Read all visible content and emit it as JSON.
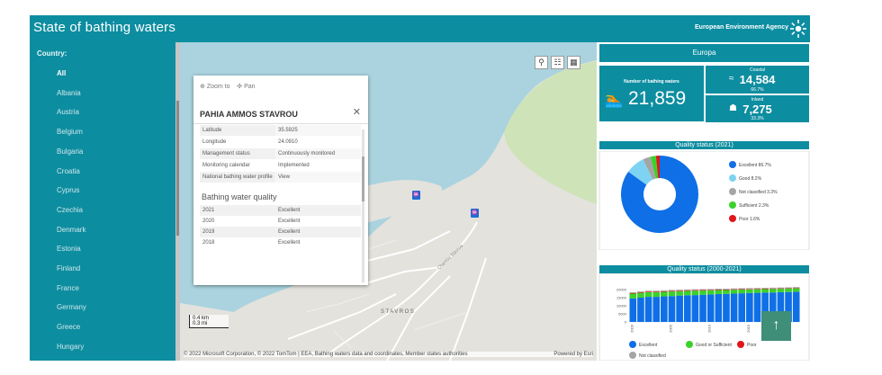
{
  "header": {
    "title": "State of bathing waters",
    "agency": "European Environment Agency"
  },
  "sidebar": {
    "label": "Country:",
    "countries": [
      "All",
      "Albania",
      "Austria",
      "Belgium",
      "Bulgaria",
      "Croatia",
      "Cyprus",
      "Czechia",
      "Denmark",
      "Estonia",
      "Finland",
      "France",
      "Germany",
      "Greece",
      "Hungary"
    ],
    "selected": "All"
  },
  "map": {
    "buttons": {
      "search": "⚲",
      "list": "☷",
      "grid": "▦"
    },
    "place_label": "STAVROS",
    "road_label": "Chaniou Stavrou",
    "scale": {
      "km": "0.4 km",
      "mi": "0.3 mi"
    },
    "attribution": "© 2022 Microsoft Corporation, © 2022 TomTom | EEA, Bathing waters data and coordinates, Member states authorities",
    "powered_by": "Powered by Esri"
  },
  "popup": {
    "zoom_to": "Zoom to",
    "pan": "Pan",
    "title": "PAHIA AMMOS STAVROU",
    "close": "✕",
    "properties": [
      {
        "key": "Latitude",
        "value": "35.5925"
      },
      {
        "key": "Longitude",
        "value": "24.0910"
      },
      {
        "key": "Management status",
        "value": "Continuously monitored"
      },
      {
        "key": "Monitoring calendar",
        "value": "Implemented"
      },
      {
        "key": "National bathing water profile",
        "value": "View"
      }
    ],
    "quality_title": "Bathing water quality",
    "quality": [
      {
        "year": "2021",
        "value": "Excellent"
      },
      {
        "year": "2020",
        "value": "Excellent"
      },
      {
        "year": "2019",
        "value": "Excellent"
      },
      {
        "year": "2018",
        "value": "Excellent"
      }
    ]
  },
  "panel": {
    "region": "Europa",
    "total": {
      "caption": "Number of bathing waters",
      "value": "21,859"
    },
    "coastal": {
      "caption": "Coastal",
      "value": "14,584",
      "pct": "66.7%"
    },
    "inland": {
      "caption": "Inland",
      "value": "7,275",
      "pct": "33.3%"
    },
    "quality_2021_title": "Quality status (2021)",
    "quality_trend_title": "Quality status (2000-2021)"
  },
  "colors": {
    "accent": "#0d8da0",
    "excellent": "#0f6fe6",
    "good": "#7fd3f2",
    "not_classified": "#a5a5a5",
    "sufficient": "#3bd12b",
    "poor": "#e0161a"
  },
  "chart_data": [
    {
      "type": "pie",
      "title": "Quality status (2021)",
      "labels": [
        "Excellent",
        "Good",
        "Not classified",
        "Sufficient",
        "Poor"
      ],
      "legend_text": [
        "Excellent 86.7%",
        "Good 8.2%",
        "Not classified 3.3%",
        "Sufficient 2.3%",
        "Poor 1.6%"
      ],
      "values": [
        86.7,
        8.2,
        3.3,
        2.3,
        1.6
      ],
      "donut": true,
      "legend": "right"
    },
    {
      "type": "bar",
      "title": "Quality status (2000-2021)",
      "stacked": true,
      "categories": [
        "2000",
        "2001",
        "2002",
        "2003",
        "2004",
        "2005",
        "2006",
        "2007",
        "2008",
        "2009",
        "2010",
        "2011",
        "2012",
        "2013",
        "2014",
        "2015",
        "2016",
        "2017",
        "2018",
        "2019",
        "2020",
        "2021"
      ],
      "x_tick_labels": [
        "2000",
        "2005",
        "2010",
        "2015",
        "2020"
      ],
      "y_ticks": [
        "20000",
        "15000",
        "10000",
        "5000",
        "0"
      ],
      "ylim": [
        0,
        25000
      ],
      "series": [
        {
          "name": "Excellent",
          "values": [
            14500,
            15000,
            15500,
            15500,
            15800,
            16000,
            16300,
            16500,
            16600,
            16800,
            17000,
            17200,
            17300,
            17500,
            17700,
            17900,
            18000,
            18100,
            18200,
            18400,
            18500,
            18700
          ]
        },
        {
          "name": "Good or Sufficient",
          "values": [
            3000,
            3000,
            2900,
            2900,
            2800,
            2800,
            2700,
            2700,
            2700,
            2600,
            2500,
            2500,
            2400,
            2400,
            2300,
            2200,
            2200,
            2200,
            2200,
            2100,
            2100,
            2100
          ]
        },
        {
          "name": "Poor",
          "values": [
            400,
            400,
            400,
            400,
            400,
            380,
            380,
            360,
            360,
            340,
            340,
            320,
            320,
            300,
            300,
            300,
            290,
            290,
            280,
            280,
            270,
            260
          ]
        },
        {
          "name": "Not classified",
          "values": [
            500,
            500,
            500,
            500,
            500,
            500,
            500,
            500,
            500,
            500,
            500,
            500,
            500,
            500,
            500,
            500,
            500,
            500,
            500,
            500,
            500,
            500
          ]
        }
      ],
      "legend_labels": [
        "Excellent",
        "Good or Sufficient",
        "Poor",
        "Not classified"
      ],
      "legend": "bottom"
    }
  ]
}
